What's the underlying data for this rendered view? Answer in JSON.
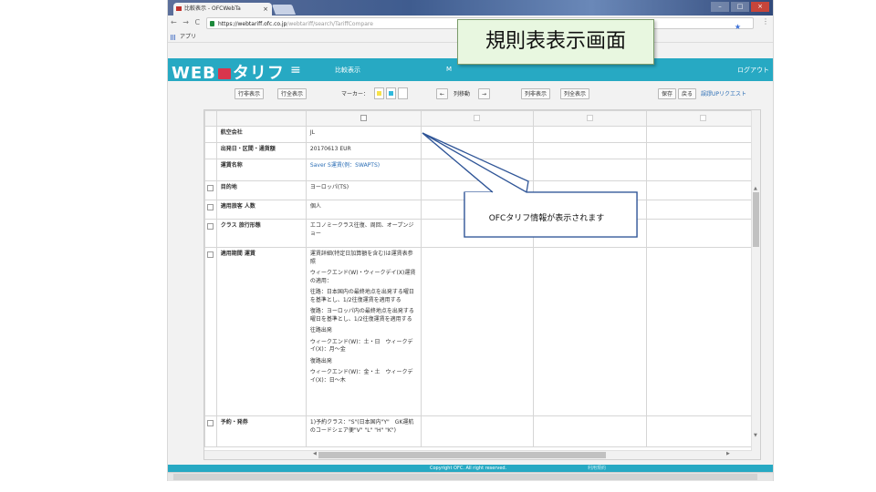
{
  "browser": {
    "tab_title": "比較表示 - OFCWebTa",
    "tab_close": "×",
    "nav_buttons": "← → C",
    "url_domain": "https://webtariff.ofc.co.jp",
    "url_path": "/webtariff/search/TariffCompare",
    "star": "★",
    "menu": "⋮",
    "bookmarks_label": "アプリ"
  },
  "app": {
    "logo_left": "WEB",
    "logo_right": "タリフ",
    "hamburger": "≡",
    "nav_compare": "比較表示",
    "nav_m": "M",
    "logout": "ログアウト",
    "accent_color": "#27a9c3",
    "brand_mark_color": "#d8364d"
  },
  "toolbar": {
    "row_hide": "行非表示",
    "row_show_all": "行全表示",
    "marker_label": "マーカー：",
    "marker_colors": [
      "#f7e24a",
      "#30b9dc",
      "#ffffff"
    ],
    "col_move_left": "←",
    "col_move_label": "列移動",
    "col_move_right": "→",
    "col_hide": "列非表示",
    "col_show_all": "列全表示",
    "save": "保存",
    "back": "戻る",
    "error_report": "誤謬UPリクエスト"
  },
  "table": {
    "rows": [
      {
        "label": "航空会社",
        "value": "JL"
      },
      {
        "label": "出発日・区間・通貨額",
        "value": "20170613 EUR"
      },
      {
        "label": "運賃名称",
        "value": "Saver S運賃(例：SWAPTS)"
      },
      {
        "label": "目的地",
        "value": "ヨーロッパ(TS)"
      },
      {
        "label": "適用旅客 人数",
        "value": "個人"
      },
      {
        "label": "クラス 旅行形態",
        "value": "エコノミークラス往復、周回、オープンジョー"
      },
      {
        "label": "適用期間 運賃",
        "paragraphs": [
          "運賃詳細(特定日加算額を含む)は運賃表参照",
          "ウィークエンド(W)・ウィークデイ(X)運賃の適用：",
          "往路：日本国内の最終地点を出発する曜日を基準とし、1/2往復運賃を適用する",
          "復路：ヨーロッパ内の最終地点を出発する曜日を基準とし、1/2往復運賃を適用する",
          "往路出発",
          "ウィークエンド(W)：土・日　ウィークデイ(X)：月～金",
          "復路出発",
          "ウィークエンド(W)：金・土　ウィークデイ(X)：日～木"
        ]
      },
      {
        "label": "予約・発券",
        "value": "1)予約クラス：\"S\"(日本国内\"Y\"　GK運航のコードシェア便\"V\" \"L\" \"H\" \"K\")"
      }
    ]
  },
  "footer": {
    "copyright": "Copyright OFC. All right reserved.",
    "tail": "利用規約"
  },
  "annotations": {
    "title": "規則表表示画面",
    "callout": "OFCタリフ情報が表示されます",
    "title_bg": "#e8f7e0"
  }
}
